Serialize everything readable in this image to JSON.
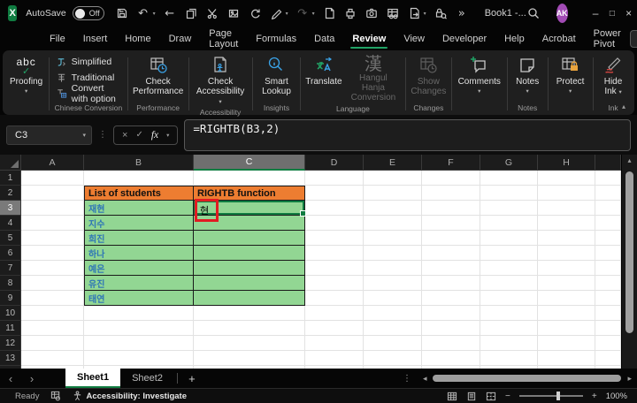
{
  "titlebar": {
    "autosave_label": "AutoSave",
    "autosave_state": "Off",
    "document_title": "Book1 -...",
    "avatar_initials": "AK"
  },
  "glyphs": {
    "chevron_down": "▾",
    "chevron_up": "▴",
    "undo": "↶",
    "redo": "↷",
    "back_arrow": "←",
    "overflow": "»",
    "minimize": "–",
    "maximize": "□",
    "close": "×",
    "ellipsis_v": "⋮",
    "cancel": "×",
    "check": "✓",
    "fx": "fx",
    "abc": "abc",
    "hanja": "漢",
    "prev_sheet": "‹",
    "next_sheet": "›",
    "add_sheet": "+",
    "scroll_up": "▴",
    "scroll_left": "◂",
    "scroll_right": "▸",
    "zoom_out": "−",
    "zoom_in": "+"
  },
  "ribbon_tabs": {
    "items": [
      "File",
      "Insert",
      "Home",
      "Draw",
      "Page Layout",
      "Formulas",
      "Data",
      "Review",
      "View",
      "Developer",
      "Help",
      "Acrobat",
      "Power Pivot"
    ],
    "active_tab": "Review",
    "comments_button": "Comments"
  },
  "ribbon": {
    "proofing": {
      "icon_text": "abc",
      "label": "Proofing"
    },
    "chinese_conversion": {
      "items": [
        "Simplified",
        "Traditional",
        "Convert with option"
      ],
      "group_label": "Chinese Conversion"
    },
    "performance": {
      "button_label": "Check Performance",
      "group_label": "Performance"
    },
    "accessibility": {
      "button_label": "Check Accessibility",
      "group_label": "Accessibility"
    },
    "insights": {
      "button_label": "Smart Lookup",
      "group_label": "Insights"
    },
    "language": {
      "translate_label": "Translate",
      "hangul_label": "Hangul Hanja Conversion",
      "group_label": "Language"
    },
    "changes": {
      "button_label": "Show Changes",
      "group_label": "Changes"
    },
    "comments": {
      "button_label": "Comments"
    },
    "notes": {
      "button_label": "Notes",
      "group_label": "Notes"
    },
    "protect": {
      "button_label": "Protect"
    },
    "ink": {
      "button_label": "Hide Ink",
      "group_label": "Ink"
    }
  },
  "formula_bar": {
    "cell_reference": "C3",
    "formula": "=RIGHTB(B3,2)"
  },
  "grid": {
    "column_headers": [
      "A",
      "B",
      "C",
      "D",
      "E",
      "F",
      "G",
      "H"
    ],
    "row_headers": [
      "1",
      "2",
      "3",
      "4",
      "5",
      "6",
      "7",
      "8",
      "9",
      "10",
      "11",
      "12",
      "13"
    ],
    "selected_column": "C",
    "selected_row": "3"
  },
  "table": {
    "header_b": "List of students",
    "header_c": "RIGHTB function",
    "students": [
      "재현",
      "지수",
      "희진",
      "하나",
      "예은",
      "유진",
      "태연"
    ],
    "c3_result": "현"
  },
  "sheet_bar": {
    "sheet1": "Sheet1",
    "sheet2": "Sheet2"
  },
  "status_bar": {
    "mode": "Ready",
    "accessibility_status": "Accessibility: Investigate",
    "zoom_percent": "100%"
  },
  "colors": {
    "excel_green": "#107C41",
    "tab_underline_green": "#21A366",
    "table_header_orange": "#ED7D31",
    "cell_fill_green": "#92D693",
    "student_text_blue": "#2E75B6",
    "annotation_red": "#E11B22",
    "avatar_purple": "#A24BB5"
  }
}
